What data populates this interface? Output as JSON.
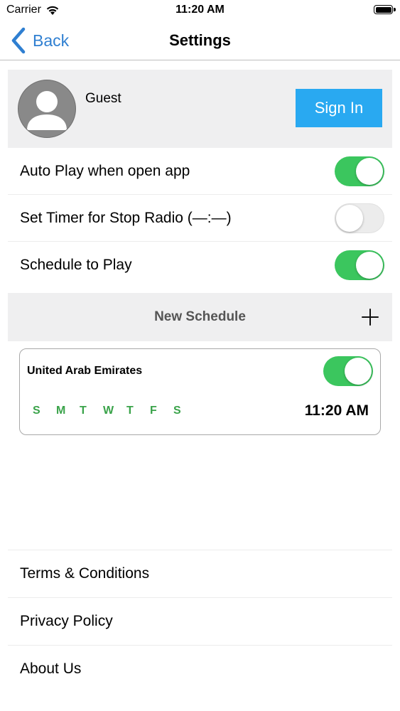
{
  "status_bar": {
    "carrier": "Carrier",
    "time": "11:20 AM"
  },
  "nav": {
    "back_label": "Back",
    "title": "Settings"
  },
  "profile": {
    "name": "Guest",
    "sign_in_label": "Sign In"
  },
  "settings": [
    {
      "label": "Auto Play when open app",
      "enabled": true
    },
    {
      "label": "Set Timer for Stop Radio (—:—)",
      "enabled": false
    },
    {
      "label": "Schedule to Play",
      "enabled": true
    }
  ],
  "new_schedule": {
    "label": "New Schedule",
    "icon": "plus-icon"
  },
  "schedule_card": {
    "country": "United Arab Emirates",
    "enabled": true,
    "days": [
      "S",
      "M",
      "T",
      "W",
      "T",
      "F",
      "S"
    ],
    "time": "11:20 AM"
  },
  "links": [
    {
      "label": "Terms & Conditions"
    },
    {
      "label": "Privacy Policy"
    },
    {
      "label": "About Us"
    }
  ],
  "colors": {
    "accent_blue": "#2f7fd1",
    "sign_in_blue": "#29a9f1",
    "toggle_green": "#3bc65e",
    "day_green": "#3aa34a"
  }
}
